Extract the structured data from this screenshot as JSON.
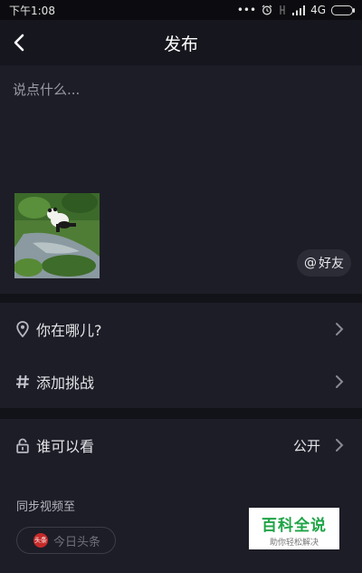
{
  "status_bar": {
    "time": "下午1:08",
    "dots": "•••",
    "network": "4G"
  },
  "header": {
    "title": "发布"
  },
  "compose": {
    "placeholder": "说点什么...",
    "friend_button_label": "好友",
    "friend_button_icon": "at-icon"
  },
  "options": [
    {
      "label": "你在哪儿?",
      "icon": "location-pin-icon"
    },
    {
      "label": "添加挑战",
      "icon": "hashtag-icon"
    }
  ],
  "privacy": {
    "label": "谁可以看",
    "value": "公开",
    "icon": "lock-icon"
  },
  "sync": {
    "label": "同步视频至",
    "target_label": "今日头条",
    "target_logo_text": "头条"
  },
  "watermark": {
    "title": "百科全说",
    "subtitle": "助你轻松解决"
  },
  "colors": {
    "background": "#15151d",
    "panel": "#1d1d27",
    "text": "#e4e4e8",
    "watermark_green": "#1fa447"
  }
}
